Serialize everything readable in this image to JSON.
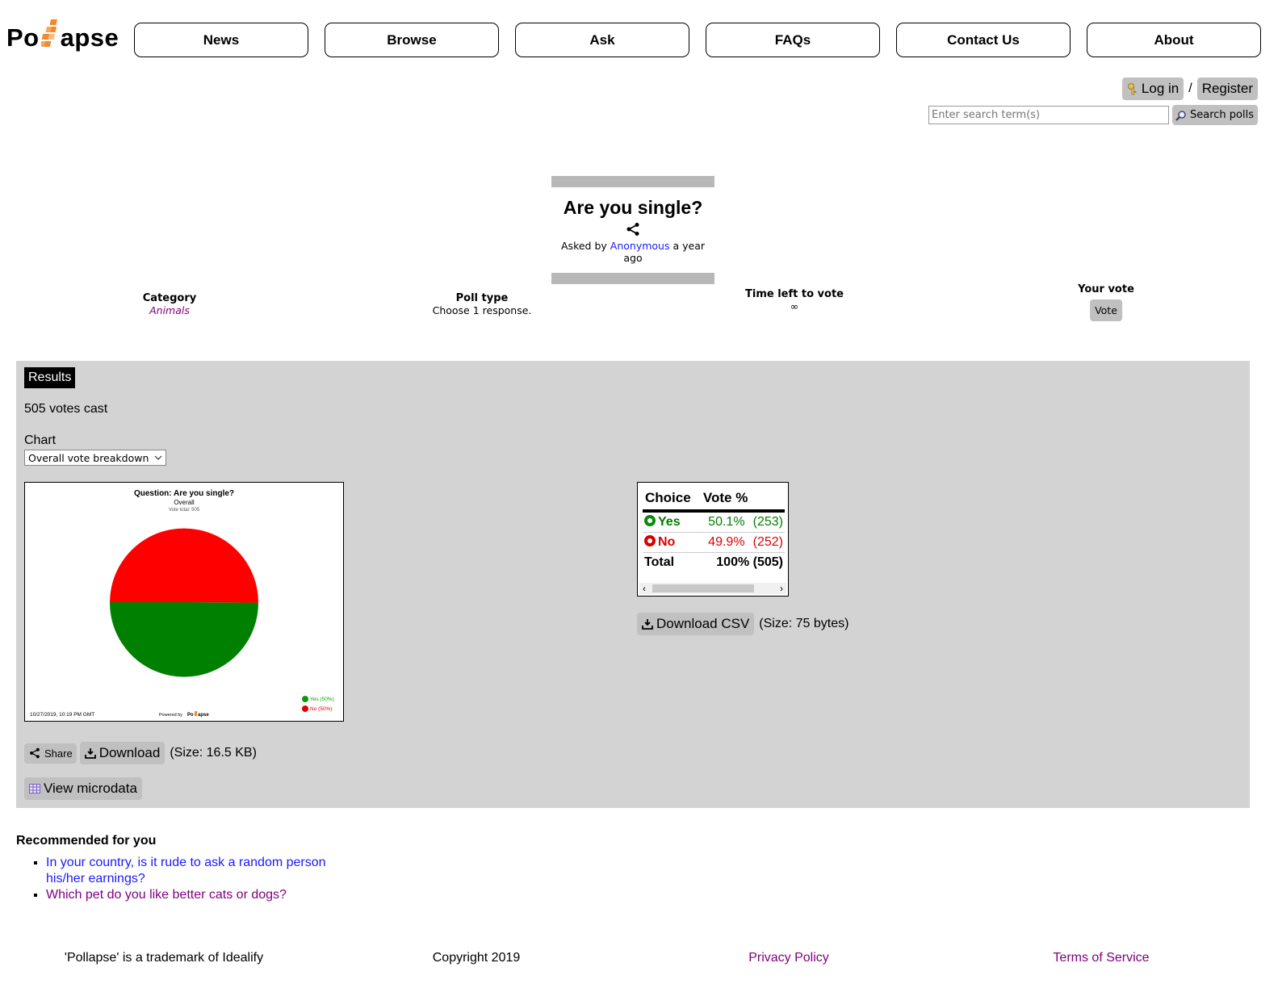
{
  "logo": {
    "text_left": "Po",
    "text_right": "apse"
  },
  "nav": [
    "News",
    "Browse",
    "Ask",
    "FAQs",
    "Contact Us",
    "About"
  ],
  "auth": {
    "login": "Log in",
    "separator": "/",
    "register": "Register"
  },
  "search": {
    "placeholder": "Enter search term(s)",
    "button": "Search polls"
  },
  "question": {
    "title": "Are you single?",
    "asked_prefix": "Asked by",
    "author": "Anonymous",
    "asked_suffix": "a year ago"
  },
  "meta": {
    "category_label": "Category",
    "category_value": "Animals",
    "poll_type_label": "Poll type",
    "poll_type_value": "Choose 1 response.",
    "time_left_label": "Time left to vote",
    "time_left_value": "∞",
    "your_vote_label": "Your vote",
    "vote_button": "Vote"
  },
  "results": {
    "tab_label": "Results",
    "votes_cast": "505 votes cast",
    "chart_label": "Chart",
    "chart_select": "Overall vote breakdown",
    "share": "Share",
    "download": "Download",
    "download_size": "(Size: 16.5 KB)",
    "view_microdata": "View microdata",
    "download_csv": "Download CSV",
    "csv_size": "(Size: 75 bytes)",
    "table": {
      "headers": [
        "Choice",
        "Vote %"
      ],
      "rows": [
        {
          "choice": "Yes",
          "pct": "50.1%",
          "count": "(253)",
          "color": "#008000"
        },
        {
          "choice": "No",
          "pct": "49.9%",
          "count": "(252)",
          "color": "#e00000"
        }
      ],
      "total_label": "Total",
      "total_value": "100% (505)"
    }
  },
  "chart_data": {
    "type": "pie",
    "title": "Question: Are you single?",
    "subtitle": "Overall",
    "vote_total": "Vote total: 505",
    "categories": [
      "Yes",
      "No"
    ],
    "values": [
      253,
      252
    ],
    "colors": [
      "#008000",
      "#ff0000"
    ],
    "legend": [
      "Yes (50%)",
      "No (50%)"
    ],
    "timestamp": "10/27/2019, 10:19 PM GMT",
    "powered_by": "Powered by",
    "brand_left": "Po",
    "brand_right": "apse"
  },
  "recommended": {
    "title": "Recommended for you",
    "items": [
      "In your country, is it rude to ask a random person his/her earnings?",
      "Which pet do you like better cats or dogs?"
    ]
  },
  "footer": {
    "trademark": "'Pollapse' is a trademark of Idealify",
    "copyright": "Copyright 2019",
    "privacy": "Privacy Policy",
    "terms": "Terms of Service"
  }
}
